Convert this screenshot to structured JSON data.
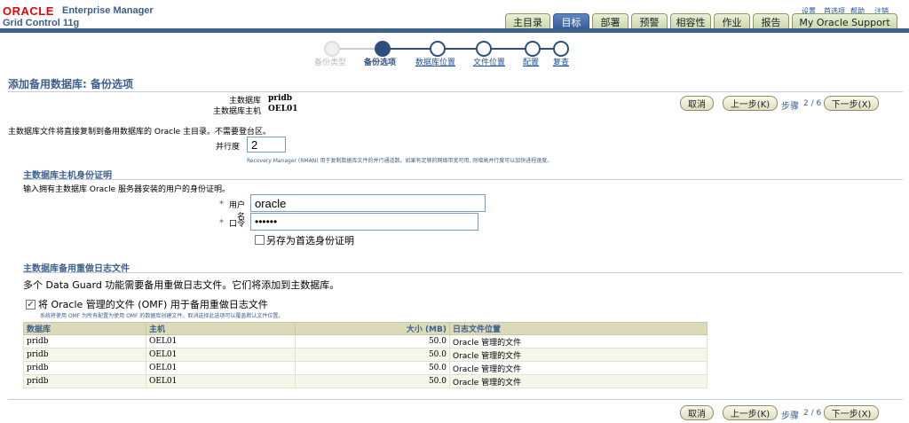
{
  "header": {
    "brand": "ORACLE",
    "product": "Enterprise Manager",
    "edition": "Grid Control 11g",
    "top_links": [
      "设置",
      "首选项",
      "帮助",
      "注销"
    ],
    "tabs": [
      {
        "label": "主目录",
        "active": false
      },
      {
        "label": "目标",
        "active": true
      },
      {
        "label": "部署",
        "active": false
      },
      {
        "label": "预警",
        "active": false
      },
      {
        "label": "相容性",
        "active": false
      },
      {
        "label": "作业",
        "active": false
      },
      {
        "label": "报告",
        "active": false
      },
      {
        "label": "My Oracle Support",
        "active": false
      }
    ]
  },
  "train": {
    "steps": [
      {
        "label": "备份类型",
        "state": "done"
      },
      {
        "label": "备份选项",
        "state": "current"
      },
      {
        "label": "数据库位置",
        "state": "todo"
      },
      {
        "label": "文件位置",
        "state": "todo"
      },
      {
        "label": "配置",
        "state": "todo"
      },
      {
        "label": "复查",
        "state": "todo"
      }
    ]
  },
  "page": {
    "title": "添加备用数据库: 备份选项",
    "primary_db_label": "主数据库",
    "primary_db_value": "pridb",
    "primary_host_label": "主数据库主机",
    "primary_host_value": "OEL01"
  },
  "nav": {
    "cancel": "取消",
    "back": "上一步(K)",
    "step_word": "步骤",
    "step_count": "2 / 6",
    "next": "下一步(X)"
  },
  "backup": {
    "intro": "主数据库文件将直接复制到备用数据库的  Oracle 主目录。不需要登台区。",
    "parallel_label": "并行度",
    "parallel_value": "2",
    "parallel_hint": "Recovery Manager (RMAN) 用于复制数据库文件的并行通道数。如果有足够的网络带宽可用, 则增高并行度可以加快进程速度。"
  },
  "credentials": {
    "section_title": "主数据库主机身份证明",
    "desc": "输入拥有主数据库  Oracle 服务器安装的用户的身份证明。",
    "username_label": "用户名",
    "username_value": "oracle",
    "password_label": "口令",
    "password_value": "oracle",
    "save_pref_label": "另存为首选身份证明",
    "required_mark": "*"
  },
  "redo": {
    "section_title": "主数据库备用重做日志文件",
    "desc": "多个  Data Guard 功能需要备用重做日志文件。它们将添加到主数据库。",
    "omf_label": "将  Oracle 管理的文件  (OMF) 用于备用重做日志文件",
    "omf_hint": "系统将使用  OMF 为所有配置为使用  OMF 的数据库创建文件。取消选择此选项可以覆盖默认文件位置。",
    "columns": [
      "数据库",
      "主机",
      "大小 (MB)",
      "日志文件位置"
    ],
    "rows": [
      [
        "pridb",
        "OEL01",
        "50.0",
        "Oracle 管理的文件"
      ],
      [
        "pridb",
        "OEL01",
        "50.0",
        "Oracle 管理的文件"
      ],
      [
        "pridb",
        "OEL01",
        "50.0",
        "Oracle 管理的文件"
      ],
      [
        "pridb",
        "OEL01",
        "50.0",
        "Oracle 管理的文件"
      ]
    ]
  },
  "colors": {
    "brand_red": "#ee0000",
    "header_blue": "#3d5f8c",
    "tab_active": "#2f5a97",
    "tab_inactive": "#d8e0bd"
  }
}
